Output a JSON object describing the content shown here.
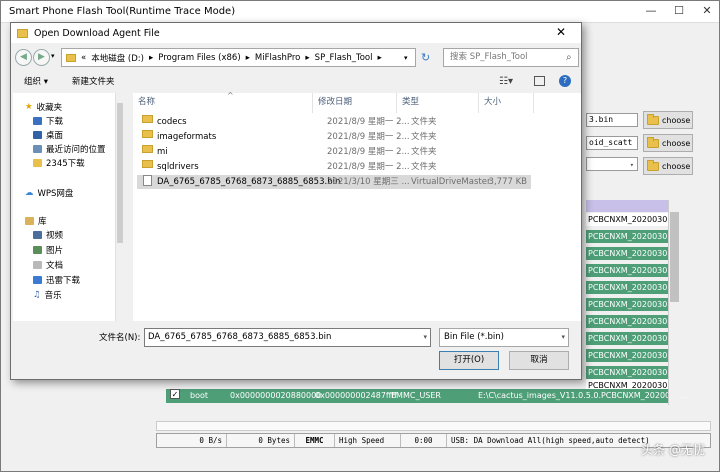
{
  "main": {
    "title": "Smart Phone Flash Tool(Runtime Trace Mode)",
    "fields": [
      "3.bin",
      "oid_scatt"
    ],
    "choose_label": "choose",
    "rows_green": [
      "PCBCNXM_2020030...",
      "PCBCNXM_2020030...",
      "PCBCNXM_2020030...",
      "PCBCNXM_2020030...",
      "PCBCNXM_2020030...",
      "PCBCNXM_2020030...",
      "PCBCNXM_2020030...",
      "PCBCNXM_2020030...",
      "PCBCNXM_2020030...",
      "PCBCNXM_2020030..."
    ],
    "rows_white": [
      "PCBCNXM_2020030...",
      "PCBCNXM_2020030..."
    ],
    "boot_row": {
      "checked": "✓",
      "name": "boot",
      "begin": "0x0000000020880000",
      "end": "0x000000002487ffff",
      "region": "EMMC_USER",
      "location": "E:\\C\\cactus_images_V11.0.5.0.PCBCNXM_2020030..."
    },
    "status": {
      "speed": "0 B/s",
      "bytes": "0 Bytes",
      "storage": "EMMC",
      "mode": "High Speed",
      "time": "0:00",
      "usb": "USB: DA Download All(high speed,auto detect)"
    },
    "watermark": "头条 @无忧"
  },
  "dialog": {
    "title": "Open Download Agent File",
    "path": [
      "«",
      "本地磁盘 (D:)",
      "Program Files (x86)",
      "MiFlashPro",
      "SP_Flash_Tool"
    ],
    "search_placeholder": "搜索 SP_Flash_Tool",
    "organize": "组织 ▾",
    "new_folder": "新建文件夹",
    "nav": {
      "favorites": "收藏夹",
      "downloads": "下载",
      "desktop": "桌面",
      "recent": "最近访问的位置",
      "d2345": "2345下载",
      "wps": "WPS网盘",
      "library": "库",
      "videos": "视频",
      "pictures": "图片",
      "documents": "文档",
      "thunder": "迅雷下载",
      "music": "音乐"
    },
    "columns": {
      "name": "名称",
      "date": "修改日期",
      "type": "类型",
      "size": "大小"
    },
    "files": [
      {
        "name": "codecs",
        "date": "2021/8/9 星期一 2...",
        "type": "文件夹",
        "size": ""
      },
      {
        "name": "imageformats",
        "date": "2021/8/9 星期一 2...",
        "type": "文件夹",
        "size": ""
      },
      {
        "name": "mi",
        "date": "2021/8/9 星期一 2...",
        "type": "文件夹",
        "size": ""
      },
      {
        "name": "sqldrivers",
        "date": "2021/8/9 星期一 2...",
        "type": "文件夹",
        "size": ""
      },
      {
        "name": "DA_6765_6785_6768_6873_6885_6853.bin",
        "date": "2021/3/10 星期三 ...",
        "type": "VirtualDriveMaster",
        "size": "3,777 KB"
      }
    ],
    "filename_label": "文件名(N):",
    "filename_value": "DA_6765_6785_6768_6873_6885_6853.bin",
    "filter": "Bin File (*.bin)",
    "open": "打开(O)",
    "cancel": "取消"
  }
}
